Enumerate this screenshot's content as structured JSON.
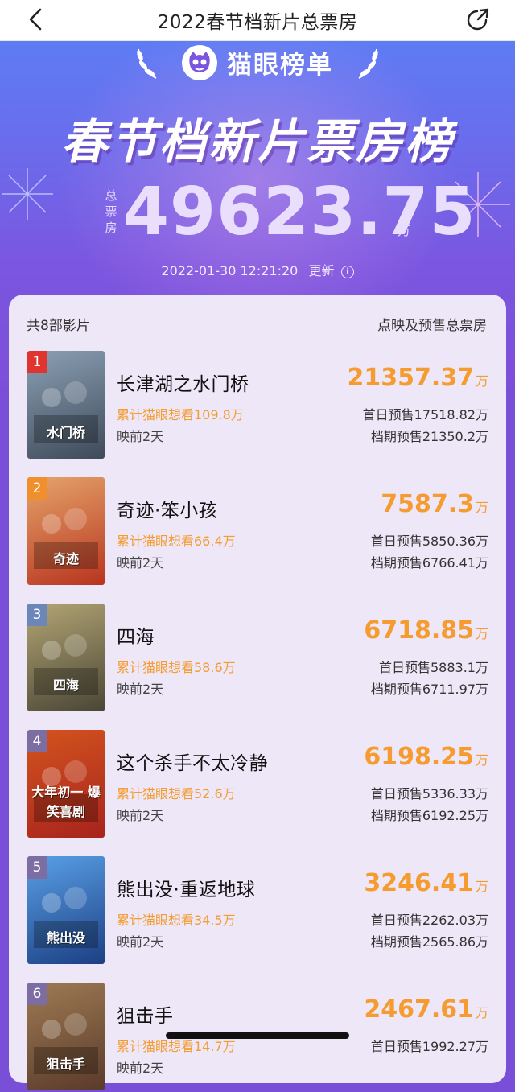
{
  "nav": {
    "title": "2022春节档新片总票房"
  },
  "hero": {
    "brand": "猫眼榜单",
    "title": "春节档新片票房榜",
    "total_label": [
      "总",
      "票",
      "房"
    ],
    "total_value": "49623.75",
    "total_unit": "万",
    "update_time": "2022-01-30  12:21:20",
    "update_label": "更新",
    "info_glyph": "i"
  },
  "list": {
    "count_label": "共8部影片",
    "column_label": "点映及预售总票房",
    "items": [
      {
        "rank": "1",
        "title": "长津湖之水门桥",
        "box": "21357.37",
        "unit": "万",
        "want": "累计猫眼想看109.8万",
        "days": "映前2天",
        "first_day": "首日预售17518.82万",
        "period": "档期预售21350.2万",
        "poster_colors": [
          "#3e4a5a",
          "#8ca0b4"
        ],
        "poster_text": "水门桥",
        "rank_color": "#e0342f"
      },
      {
        "rank": "2",
        "title": "奇迹·笨小孩",
        "box": "7587.3",
        "unit": "万",
        "want": "累计猫眼想看66.4万",
        "days": "映前2天",
        "first_day": "首日预售5850.36万",
        "period": "档期预售6766.41万",
        "poster_colors": [
          "#b8341f",
          "#e5a46a"
        ],
        "poster_text": "奇迹",
        "rank_color": "#f0902c"
      },
      {
        "rank": "3",
        "title": "四海",
        "box": "6718.85",
        "unit": "万",
        "want": "累计猫眼想看58.6万",
        "days": "映前2天",
        "first_day": "首日预售5883.1万",
        "period": "档期预售6711.97万",
        "poster_colors": [
          "#4a4636",
          "#b3a574"
        ],
        "poster_text": "四海",
        "rank_color": "#6b86b8"
      },
      {
        "rank": "4",
        "title": "这个杀手不太冷静",
        "box": "6198.25",
        "unit": "万",
        "want": "累计猫眼想看52.6万",
        "days": "映前2天",
        "first_day": "首日预售5336.33万",
        "period": "档期预售6192.25万",
        "poster_colors": [
          "#a8231d",
          "#d3541e"
        ],
        "poster_text": "大年初一 爆笑喜剧",
        "rank_color": "#7c6ea3"
      },
      {
        "rank": "5",
        "title": "熊出没·重返地球",
        "box": "3246.41",
        "unit": "万",
        "want": "累计猫眼想看34.5万",
        "days": "映前2天",
        "first_day": "首日预售2262.03万",
        "period": "档期预售2565.86万",
        "poster_colors": [
          "#1c3f83",
          "#5aa0e6"
        ],
        "poster_text": "熊出没",
        "rank_color": "#7c6ea3"
      },
      {
        "rank": "6",
        "title": "狙击手",
        "box": "2467.61",
        "unit": "万",
        "want": "累计猫眼想看14.7万",
        "days": "映前2天",
        "first_day": "首日预售1992.27万",
        "period": "",
        "poster_colors": [
          "#5a3a2a",
          "#9e7b54"
        ],
        "poster_text": "狙击手",
        "rank_color": "#7c6ea3"
      }
    ]
  }
}
